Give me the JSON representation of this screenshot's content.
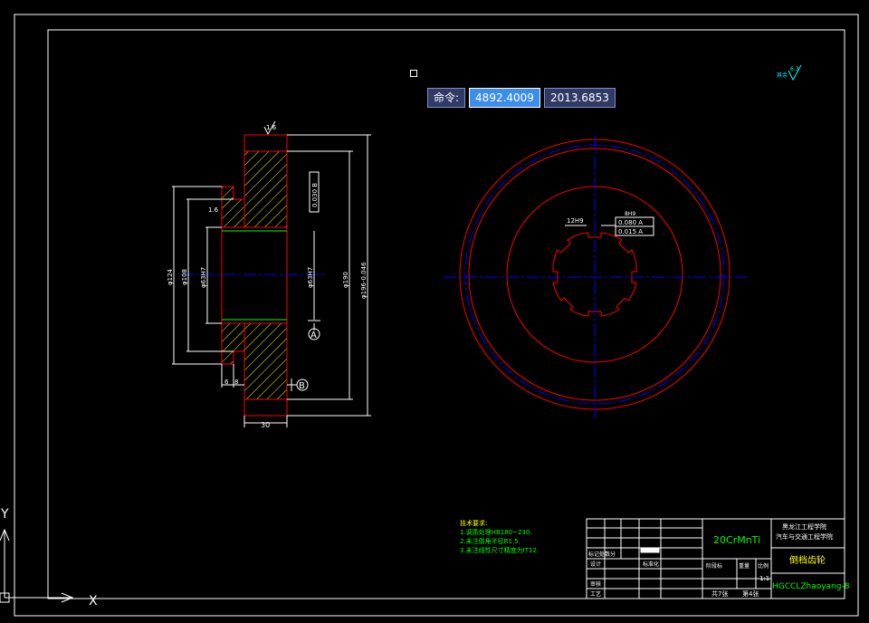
{
  "command": {
    "label": "命令:",
    "x_value": "4892.4009",
    "y_value": "2013.6853"
  },
  "drawing": {
    "material": "20CrMnTi",
    "school_line1": "黑龙江工程学院",
    "school_line2": "汽车与交通工程学院",
    "part_name": "倒档齿轮",
    "drawing_no": "HGCCLZhaoyang-8",
    "sheets_total": "共7张",
    "sheet_no": "第4张",
    "scale_label": "比例",
    "scale": "1:1",
    "stage_label": "阶段标",
    "weight_label": "重量",
    "mark_label": "标记处数分",
    "std_label": "标准化",
    "design_label": "设计",
    "review_label": "审核",
    "process_label": "工艺",
    "tech_title": "技术要求:",
    "tech_req": [
      "1.调质处理HB180~230.",
      "2.未注倒角半径R1.5.",
      "3.未注线性尺寸精度为IT12."
    ],
    "roughness_top": "1.6",
    "roughness_side": "1.6",
    "roughness_global": "6.3",
    "dim_width": "30",
    "dim_a": "A",
    "dim_b": "B",
    "dim_small_a": "6",
    "dim_small_b": "8",
    "dim_phi124": "φ124",
    "dim_phi108": "φ108",
    "dim_phi63": "φ63H7",
    "dim_phi63b": "φ63H7",
    "dim_phi190": "φ190",
    "dim_phi196": "φ196-0.046",
    "tol_frame1": "0.030 B",
    "tol_frame2_a": "0.080 A",
    "tol_frame2_b": "0.015 A",
    "dim_12": "12H9",
    "dim_8": "8H9"
  },
  "axes": {
    "y_label": "Y",
    "x_label": "X"
  },
  "colors": {
    "gear_red": "#ff0000",
    "dim_white": "#ffffff",
    "center_blue": "#0000ff",
    "hatch_yellow": "#ffff00",
    "green": "#00ff00",
    "cyan": "#00ffff"
  }
}
